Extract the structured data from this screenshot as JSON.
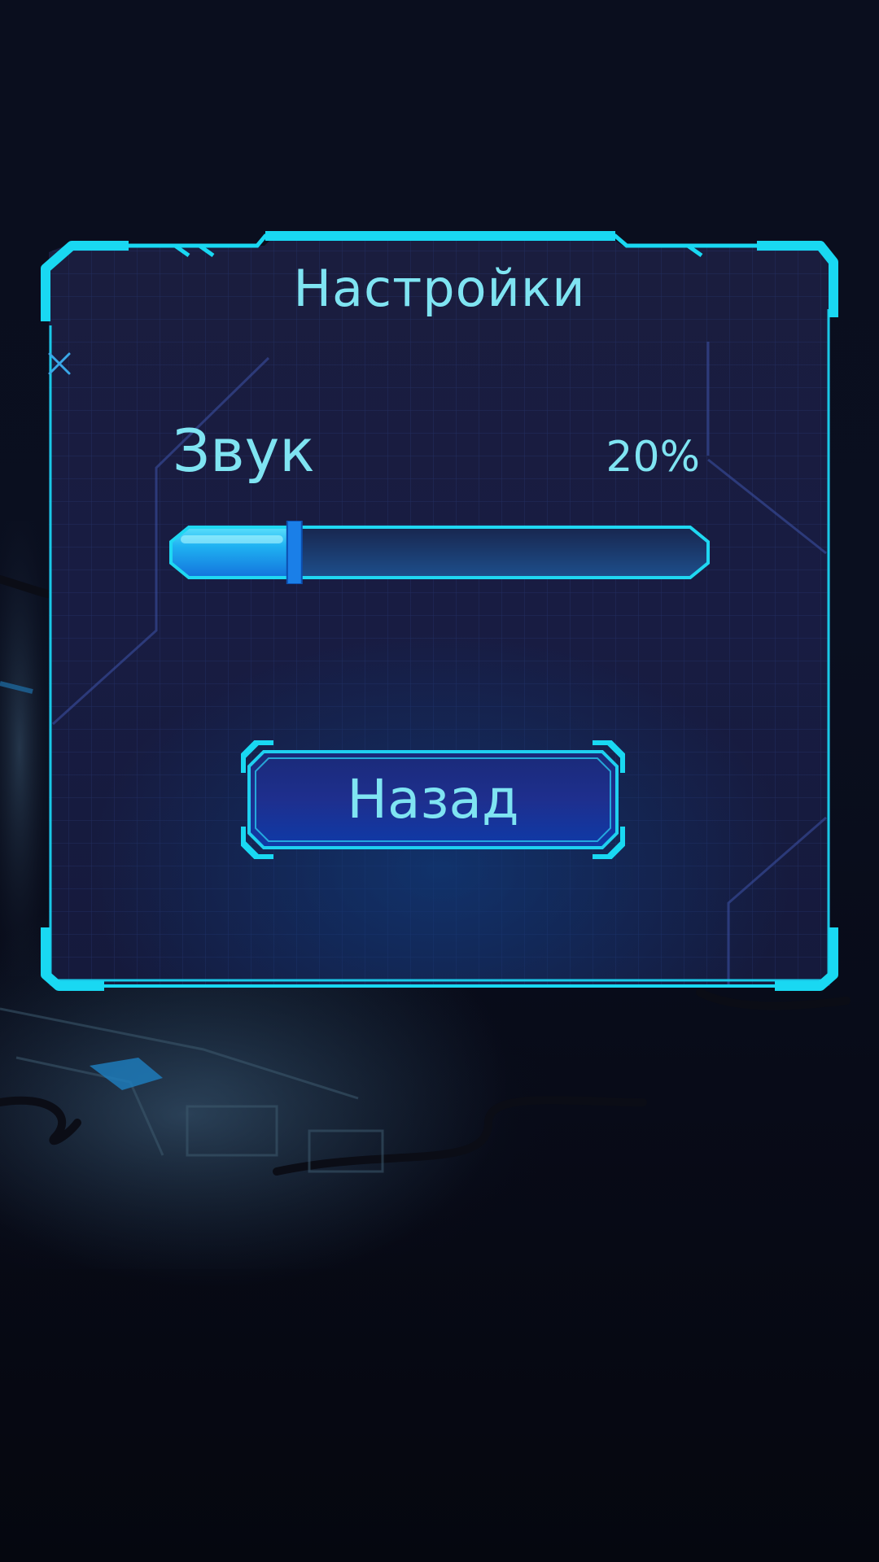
{
  "dialog": {
    "title": "Настройки",
    "close_icon": "close-icon"
  },
  "settings": {
    "sound": {
      "label": "Звук",
      "value_text": "20%",
      "level": 0.2
    }
  },
  "buttons": {
    "back_label": "Назад"
  },
  "colors": {
    "accent": "#19d8f2",
    "text": "#7fe4f2",
    "panel_bg": "#171b3a",
    "button_bg": "#102a86",
    "slider_fill": "#1aa6f0"
  }
}
